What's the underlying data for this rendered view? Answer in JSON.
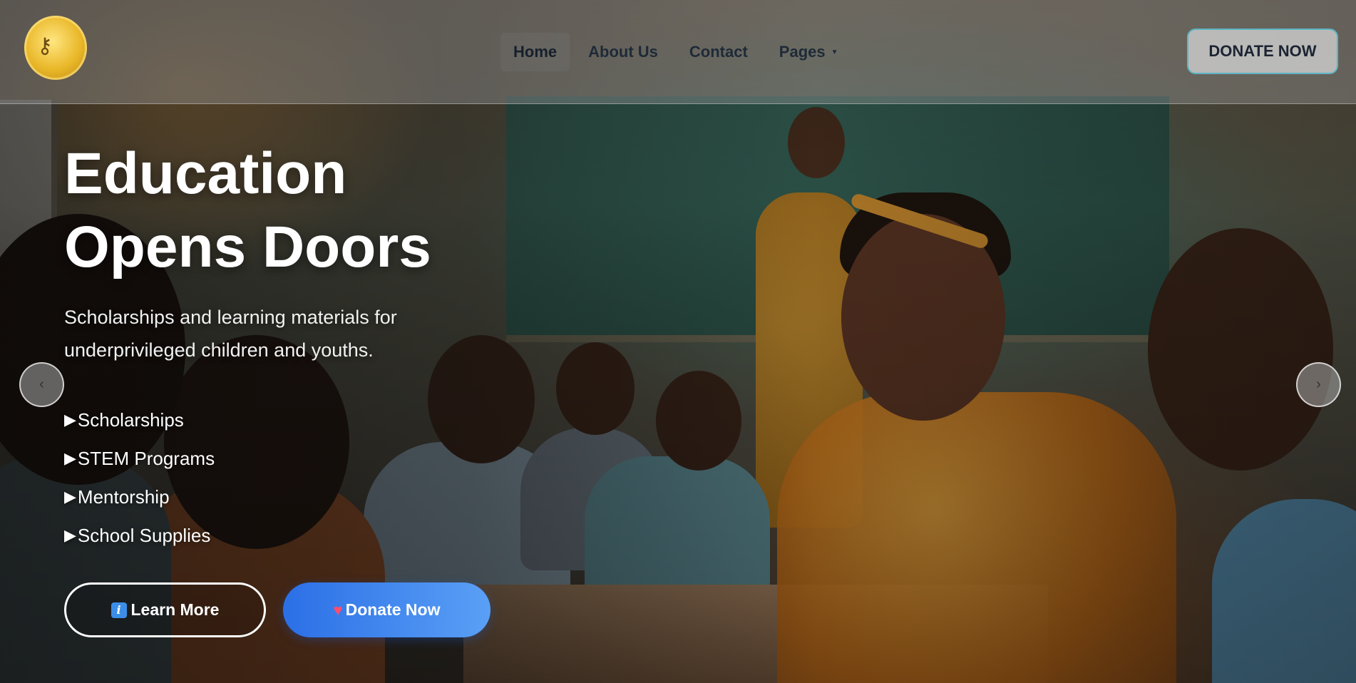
{
  "header": {
    "logo_icon": "key-logo",
    "nav": [
      {
        "label": "Home",
        "active": true
      },
      {
        "label": "About Us",
        "active": false
      },
      {
        "label": "Contact",
        "active": false
      },
      {
        "label": "Pages",
        "active": false,
        "has_dropdown": true
      }
    ],
    "donate_label": "DONATE NOW"
  },
  "hero": {
    "title_line1": "Education",
    "title_line2": "Opens Doors",
    "subtitle": "Scholarships and learning materials for underprivileged children and youths.",
    "features": [
      "Scholarships",
      "STEM Programs",
      "Mentorship",
      "School Supplies"
    ],
    "learn_more_label": "Learn More",
    "donate_label": "Donate Now",
    "prev_arrow": "‹",
    "next_arrow": "›"
  },
  "colors": {
    "donate_gradient_start": "#2b6fe6",
    "donate_gradient_end": "#5aa0f6",
    "header_border_accent": "#5fb4c4"
  }
}
